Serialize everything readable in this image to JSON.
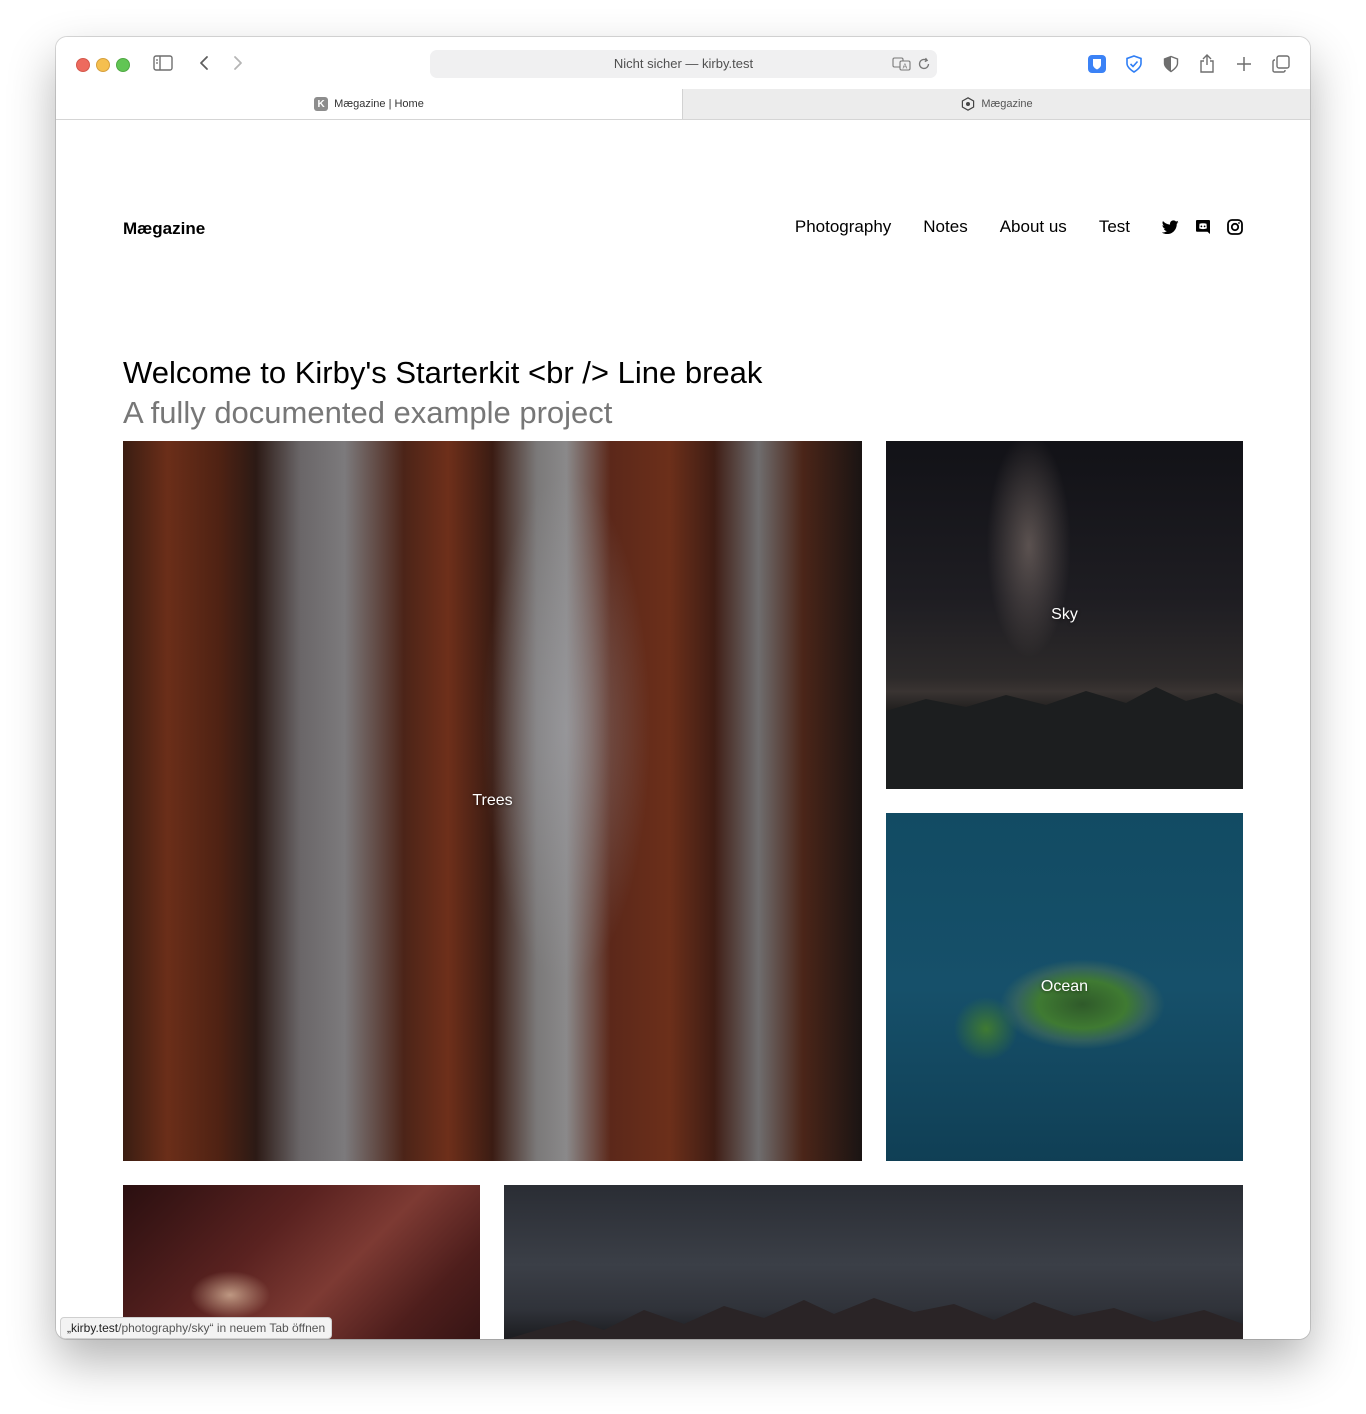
{
  "browser": {
    "address": "Nicht sicher — kirby.test",
    "tabs": [
      {
        "label": "Mægazine | Home",
        "favicon": "K"
      },
      {
        "label": "Mægazine"
      }
    ],
    "status_bar": {
      "host": "„kirby.test",
      "path": "/photography/sky“ in neuem Tab öffnen"
    }
  },
  "site": {
    "logo": "Mægazine",
    "nav": [
      "Photography",
      "Notes",
      "About us",
      "Test"
    ],
    "social_icons": [
      "twitter-icon",
      "discord-icon",
      "instagram-icon"
    ]
  },
  "hero": {
    "title": "Welcome to Kirby's Starterkit <br /> Line break",
    "subtitle": "A fully documented example project"
  },
  "gallery": {
    "trees": "Trees",
    "sky": "Sky",
    "ocean": "Ocean"
  },
  "colors": {
    "text": "#000000",
    "subtitle": "#777777",
    "tab_inactive_bg": "#ececec",
    "bitwarden": "#3b82f6"
  }
}
